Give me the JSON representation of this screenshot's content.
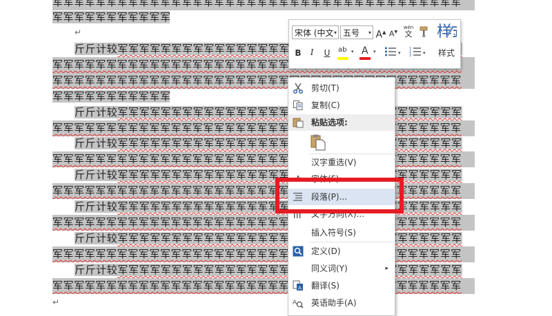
{
  "document": {
    "line_full": "军军军军军军军军军军军军军军军军军军军军军军军军军军军军军军军军军军军军军军",
    "line_end": "军军军军军军军军军军军军军军",
    "para_start": "斤斤计较",
    "para_rest": "军军军军军军军军军军军军军军军军军军军军军军军军军军军军军军军军",
    "paragraph_mark": "↵"
  },
  "mini_toolbar": {
    "font_name": "宋体 (中文",
    "font_size": "五号",
    "grow_font_label": "A",
    "shrink_font_label": "A",
    "phonetic_top": "wén",
    "phonetic_char": "文",
    "bold_label": "B",
    "italic_label": "I",
    "underline_label": "U",
    "highlight_label": "ab",
    "font_color_label": "A",
    "styles_label": "样式",
    "highlight_color": "#ffff00",
    "font_color": "#e51c23",
    "styles_color": "#2a5fa8"
  },
  "context_menu": {
    "items": [
      {
        "label": "剪切(T)",
        "icon": "scissors-icon"
      },
      {
        "label": "复制(C)",
        "icon": "copy-icon"
      },
      {
        "label": "粘贴选项:",
        "icon": "paste-icon"
      },
      {
        "label": "汉字重选(V)",
        "icon": ""
      },
      {
        "label": "字体(F)...",
        "icon": "font-icon"
      },
      {
        "label": "段落(P)...",
        "icon": "paragraph-icon"
      },
      {
        "label": "文字方向(X)...",
        "icon": "text-direction-icon"
      },
      {
        "label": "插入符号(S)",
        "icon": ""
      },
      {
        "label": "定义(D)",
        "icon": "define-icon"
      },
      {
        "label": "同义词(Y)",
        "icon": ""
      },
      {
        "label": "翻译(S)",
        "icon": "translate-icon"
      },
      {
        "label": "英语助手(A)",
        "icon": "english-assistant-icon"
      }
    ],
    "submenu_arrow": "▸",
    "highlight_box_color": "#e51c23"
  }
}
